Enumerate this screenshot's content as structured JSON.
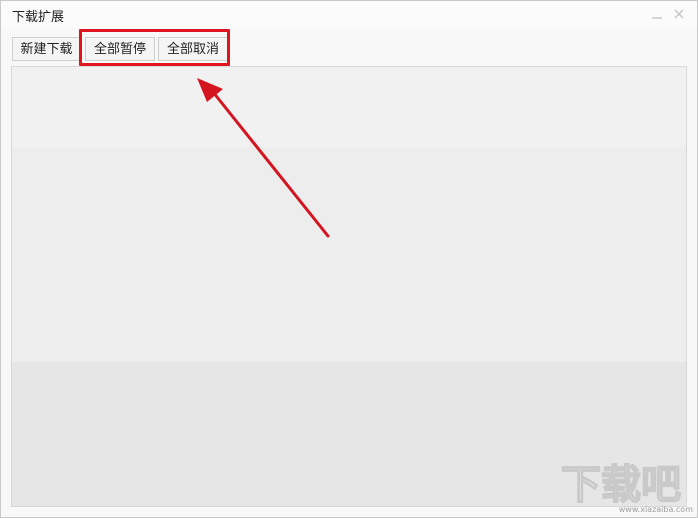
{
  "window": {
    "title": "下载扩展",
    "controls": {
      "minimize_icon": "minimize-icon",
      "close_icon": "close-icon"
    }
  },
  "toolbar": {
    "new_download_label": "新建下载",
    "pause_all_label": "全部暂停",
    "cancel_all_label": "全部取消"
  },
  "annotation": {
    "highlight_color": "#e0141e",
    "arrow_color": "#d4141e"
  },
  "watermark": {
    "logo_text": "下载吧",
    "url": "www.xiazaiba.com"
  },
  "colors": {
    "window_bg": "#f8f8f8",
    "panel_top": "#f1f1f1",
    "panel_mid": "#ededed",
    "panel_bottom": "#e6e6e6"
  }
}
